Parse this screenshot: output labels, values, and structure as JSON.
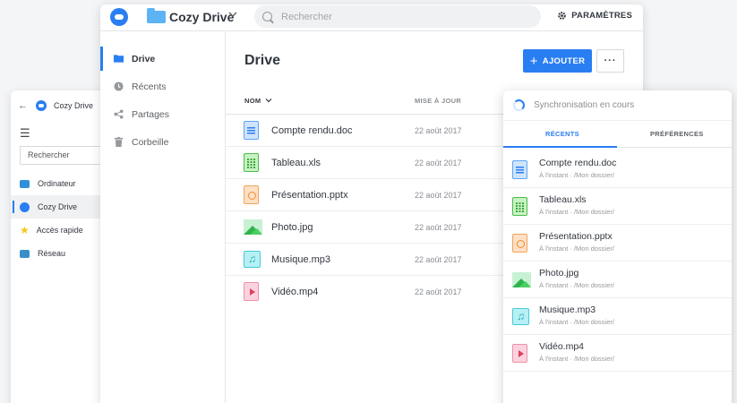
{
  "explorer": {
    "app_title": "Cozy Drive",
    "search_value": "Rechercher",
    "items": [
      {
        "label": "Ordinateur",
        "icon": "computer-icon",
        "color": "#2f8fd8"
      },
      {
        "label": "Cozy Drive",
        "icon": "cozy-cloud-icon",
        "color": "#297ef2",
        "active": true
      },
      {
        "label": "Accès rapide",
        "icon": "star-icon",
        "color": "#f7c51e"
      },
      {
        "label": "Réseau",
        "icon": "network-icon",
        "color": "#3a8fc9"
      }
    ]
  },
  "main": {
    "app_name": "Cozy Drive",
    "search_placeholder": "Rechercher",
    "settings_label": "PARAMÈTRES",
    "nav": [
      {
        "label": "Drive",
        "icon": "folder-icon",
        "active": true
      },
      {
        "label": "Récents",
        "icon": "clock-icon"
      },
      {
        "label": "Partages",
        "icon": "share-icon"
      },
      {
        "label": "Corbeille",
        "icon": "trash-icon"
      }
    ],
    "page_title": "Drive",
    "add_label": "AJOUTER",
    "more_label": "···",
    "columns": {
      "name": "NOM",
      "date": "MISE À JOUR"
    },
    "files": [
      {
        "name": "Compte rendu.doc",
        "date": "22 août 2017",
        "type": "doc"
      },
      {
        "name": "Tableau.xls",
        "date": "22 août 2017",
        "type": "xls"
      },
      {
        "name": "Présentation.pptx",
        "date": "22 août 2017",
        "type": "ppt"
      },
      {
        "name": "Photo.jpg",
        "date": "22 août 2017",
        "type": "img"
      },
      {
        "name": "Musique.mp3",
        "date": "22 août 2017",
        "type": "mp3"
      },
      {
        "name": "Vidéo.mp4",
        "date": "22 août 2017",
        "type": "mp4"
      }
    ]
  },
  "sync": {
    "status": "Synchronisation en cours",
    "tabs": {
      "recents": "RÉCENTS",
      "prefs": "PRÉFÉRENCES"
    },
    "items": [
      {
        "name": "Compte rendu.doc",
        "loc": "À l'instant · /Mon dossier/",
        "type": "doc"
      },
      {
        "name": "Tableau.xls",
        "loc": "À l'instant · /Mon dossier/",
        "type": "xls"
      },
      {
        "name": "Présentation.pptx",
        "loc": "À l'instant · /Mon dossier/",
        "type": "ppt"
      },
      {
        "name": "Photo.jpg",
        "loc": "À l'instant · /Mon dossier/",
        "type": "img"
      },
      {
        "name": "Musique.mp3",
        "loc": "À l'instant · /Mon dossier/",
        "type": "mp3"
      },
      {
        "name": "Vidéo.mp4",
        "loc": "À l'instant · /Mon dossier/",
        "type": "mp4"
      }
    ]
  },
  "colors": {
    "accent": "#297ef2",
    "text": "#32363f",
    "muted": "#8a8e93"
  }
}
